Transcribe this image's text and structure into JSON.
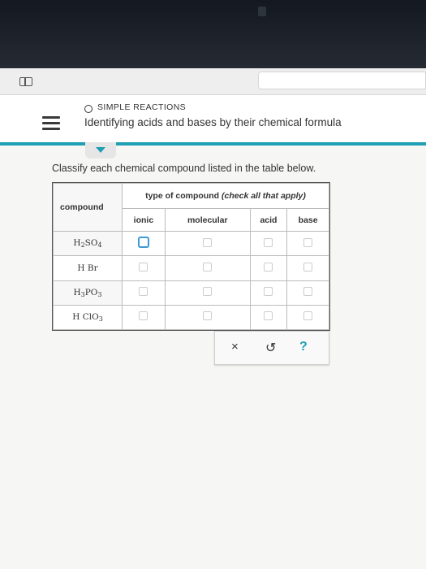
{
  "header": {
    "topic": "SIMPLE REACTIONS",
    "title": "Identifying acids and bases by their chemical formula"
  },
  "instruction": "Classify each chemical compound listed in the table below.",
  "table": {
    "compound_header": "compound",
    "type_header": "type of compound",
    "type_header_note": "(check all that apply)",
    "columns": [
      "ionic",
      "molecular",
      "acid",
      "base"
    ],
    "rows": [
      {
        "formula": [
          "H",
          "2",
          "SO",
          "4"
        ]
      },
      {
        "formula": [
          "H Br"
        ]
      },
      {
        "formula": [
          "H",
          "3",
          "PO",
          "3"
        ]
      },
      {
        "formula": [
          "H ClO",
          "3"
        ]
      }
    ]
  },
  "actions": {
    "clear": "×",
    "undo": "↺",
    "help": "?"
  },
  "colors": {
    "accent": "#1f9fb3",
    "checkbox_focus": "#3d9ad6"
  }
}
